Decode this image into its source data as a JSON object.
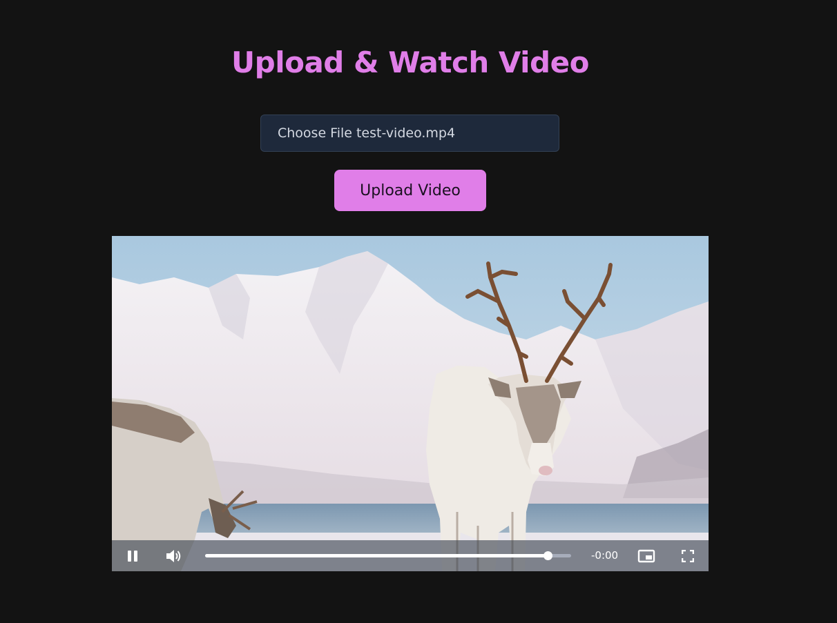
{
  "page": {
    "title": "Upload & Watch Video",
    "accent_color": "#e07ee8",
    "background_color": "#131313"
  },
  "file_input": {
    "button_label": "Choose File",
    "file_name": "test-video.mp4"
  },
  "upload_button": {
    "label": "Upload Video"
  },
  "video_player": {
    "playback_state": "playing",
    "progress": 0.935,
    "time_remaining": "-0:00",
    "controls": {
      "play_pause_icon": "pause-icon",
      "volume_icon": "volume-icon",
      "pip_icon": "picture-in-picture-icon",
      "fullscreen_icon": "fullscreen-icon"
    }
  }
}
